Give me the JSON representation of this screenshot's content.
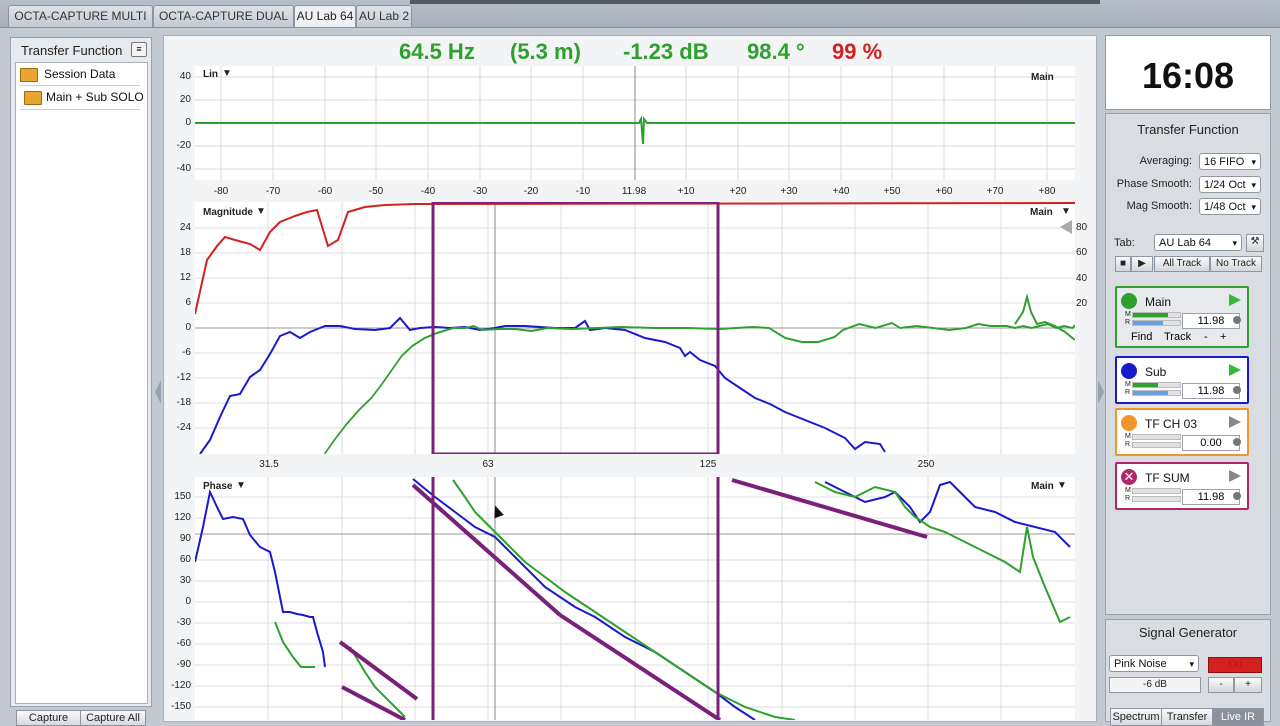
{
  "tabs": [
    {
      "label": "OCTA-CAPTURE MULTI"
    },
    {
      "label": "OCTA-CAPTURE DUAL"
    },
    {
      "label": "AU Lab 64"
    },
    {
      "label": "AU Lab 2"
    }
  ],
  "left_panel": {
    "title": "Transfer Function",
    "items": [
      {
        "label": "Session Data"
      },
      {
        "label": "Main + Sub SOLO"
      }
    ],
    "capture_label": "Capture",
    "capture_all_label": "Capture All"
  },
  "readout": {
    "freq": "64.5 Hz",
    "dist": "(5.3 m)",
    "gain": "-1.23 dB",
    "phase": "98.4 °",
    "coherence": "99 %"
  },
  "impulse": {
    "label": "Lin",
    "corner": "Main",
    "yticks": [
      "40",
      "20",
      "0",
      "-20",
      "-40"
    ],
    "xticks": [
      "-80",
      "-70",
      "-60",
      "-50",
      "-40",
      "-30",
      "-20",
      "-10",
      "11.98",
      "+10",
      "+20",
      "+30",
      "+40",
      "+50",
      "+60",
      "+70",
      "+80"
    ]
  },
  "magnitude": {
    "label": "Magnitude",
    "corner": "Main",
    "yticks": [
      "24",
      "18",
      "12",
      "6",
      "0",
      "-6",
      "-12",
      "-18",
      "-24"
    ],
    "rticks": [
      "80",
      "60",
      "40",
      "20"
    ],
    "xticks": [
      "31.5",
      "63",
      "125",
      "250"
    ]
  },
  "phase": {
    "label": "Phase",
    "corner": "Main",
    "yticks": [
      "150",
      "120",
      "90",
      "60",
      "30",
      "0",
      "-30",
      "-60",
      "-90",
      "-120",
      "-150"
    ]
  },
  "clock": "16:08",
  "tf_panel": {
    "title": "Transfer Function",
    "averaging_label": "Averaging:",
    "averaging_value": "16 FIFO",
    "phase_smooth_label": "Phase Smooth:",
    "phase_smooth_value": "1/24 Oct",
    "mag_smooth_label": "Mag Smooth:",
    "mag_smooth_value": "1/48 Oct",
    "tab_label": "Tab:",
    "tab_value": "AU Lab 64",
    "all_track": "All Track",
    "no_track": "No Track"
  },
  "tracks": [
    {
      "name": "Main",
      "value": "11.98",
      "color": "#2ea02e",
      "find": "Find",
      "track": "Track",
      "minus": "-",
      "plus": "+"
    },
    {
      "name": "Sub",
      "value": "11.98",
      "color": "#1a1acc"
    },
    {
      "name": "TF CH 03",
      "value": "0.00",
      "color": "#f0962a"
    },
    {
      "name": "TF SUM",
      "value": "11.98",
      "color": "#b0286a"
    }
  ],
  "signal": {
    "title": "Signal Generator",
    "type": "Pink Noise",
    "on_label": "On",
    "level": "-6 dB",
    "minus": "-",
    "plus": "+"
  },
  "bottom_tabs": [
    {
      "label": "Spectrum"
    },
    {
      "label": "Transfer"
    },
    {
      "label": "Live IR"
    }
  ]
}
